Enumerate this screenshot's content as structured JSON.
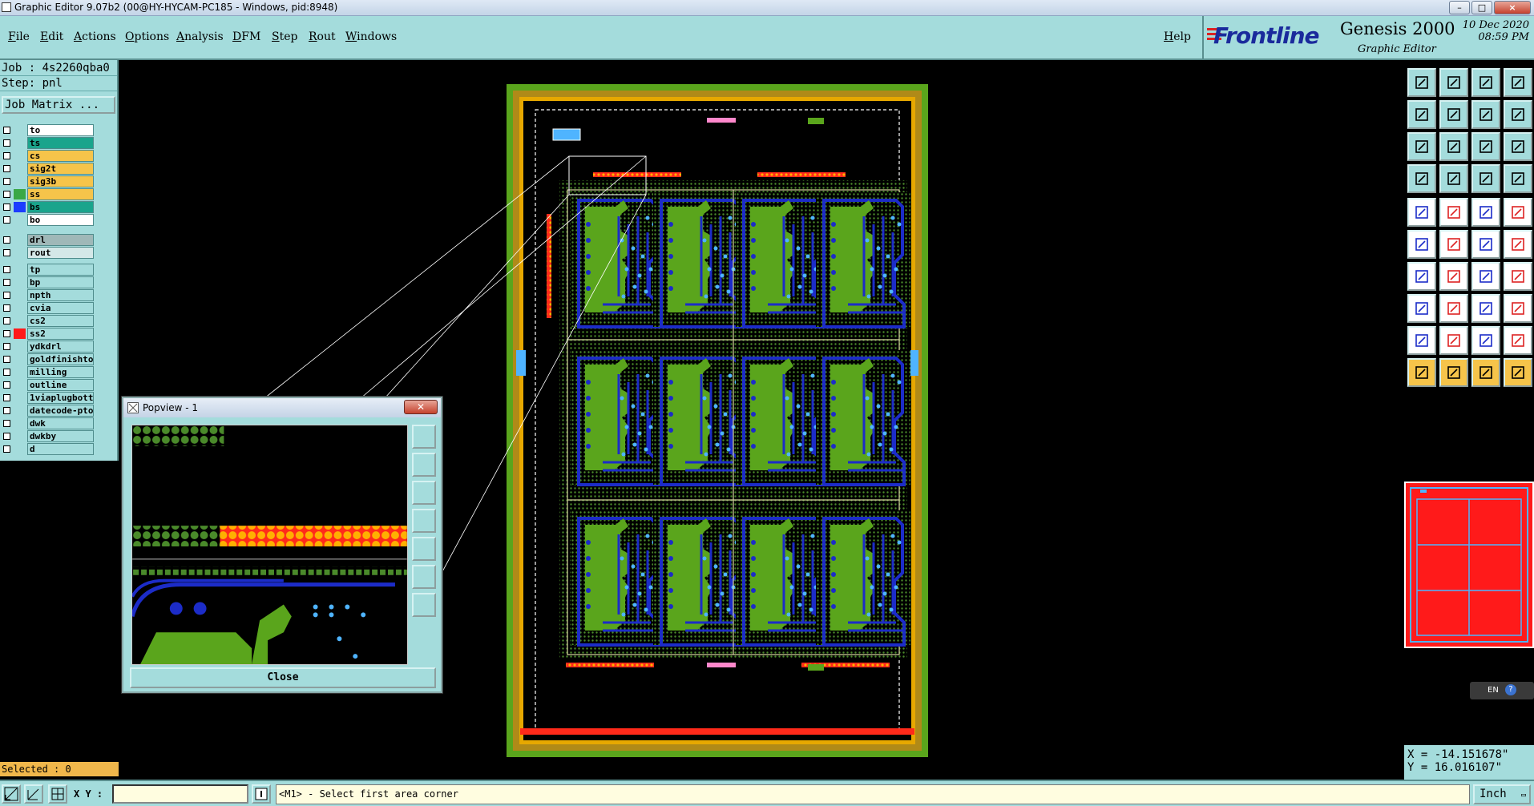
{
  "window": {
    "title": "Graphic Editor 9.07b2 (00@HY-HYCAM-PC185 - Windows, pid:8948)",
    "min_label": "–",
    "max_label": "□",
    "close_label": "×"
  },
  "menu": {
    "items": [
      "File",
      "Edit",
      "Actions",
      "Options",
      "Analysis",
      "DFM",
      "Step",
      "Rout",
      "Windows"
    ],
    "help": "Help"
  },
  "brand": {
    "logo": "Frontline",
    "product": "Genesis 2000",
    "subtitle": "Graphic Editor",
    "date": "10  Dec  2020",
    "time": "08:59  PM"
  },
  "job": {
    "job_line": "Job : 4s2260qba0",
    "step_line": "Step: pnl",
    "matrix_button": "Job Matrix ..."
  },
  "layers": [
    {
      "name": "to",
      "color": "#ffffff",
      "swatch": ""
    },
    {
      "name": "ts",
      "color": "#1aa48c",
      "swatch": ""
    },
    {
      "name": "cs",
      "color": "#f6c44a",
      "swatch": ""
    },
    {
      "name": "sig2t",
      "color": "#f6c44a",
      "swatch": ""
    },
    {
      "name": "sig3b",
      "color": "#f6c44a",
      "swatch": ""
    },
    {
      "name": "ss",
      "color": "#f6c44a",
      "swatch": "#39a845"
    },
    {
      "name": "bs",
      "color": "#1aa48c",
      "swatch": "#1c3cff"
    },
    {
      "name": "bo",
      "color": "#ffffff",
      "swatch": ""
    },
    {
      "name": "drl",
      "color": "#9fb8b8",
      "swatch": ""
    },
    {
      "name": "rout",
      "color": "#d4e8e8",
      "swatch": ""
    },
    {
      "name": "tp",
      "color": "#a4dcdc",
      "swatch": ""
    },
    {
      "name": "bp",
      "color": "#a4dcdc",
      "swatch": ""
    },
    {
      "name": "npth",
      "color": "#a4dcdc",
      "swatch": ""
    },
    {
      "name": "cvia",
      "color": "#a4dcdc",
      "swatch": ""
    },
    {
      "name": "cs2",
      "color": "#a4dcdc",
      "swatch": ""
    },
    {
      "name": "ss2",
      "color": "#a4dcdc",
      "swatch": "#ff1a1a"
    },
    {
      "name": "ydkdrl",
      "color": "#a4dcdc",
      "swatch": ""
    },
    {
      "name": "goldfinishto",
      "color": "#a4dcdc",
      "swatch": ""
    },
    {
      "name": "milling",
      "color": "#a4dcdc",
      "swatch": ""
    },
    {
      "name": "outline",
      "color": "#a4dcdc",
      "swatch": ""
    },
    {
      "name": "1viaplugbott",
      "color": "#a4dcdc",
      "swatch": ""
    },
    {
      "name": "datecode-pto",
      "color": "#a4dcdc",
      "swatch": ""
    },
    {
      "name": "dwk",
      "color": "#a4dcdc",
      "swatch": ""
    },
    {
      "name": "dwkby",
      "color": "#a4dcdc",
      "swatch": ""
    },
    {
      "name": "d",
      "color": "#a4dcdc",
      "swatch": ""
    }
  ],
  "status": {
    "selected": "Selected : 0",
    "xy_label": "X Y :",
    "xy_value": "",
    "prompt": "<M1> - Select first area corner",
    "units": "Inch",
    "coord_x": "X = -14.151678\"",
    "coord_y": "Y =  16.016107\""
  },
  "popview": {
    "title": "Popview - 1",
    "close_button": "Close"
  },
  "ime": {
    "lang": "EN"
  },
  "colors": {
    "panel": "#a4dcdc",
    "accent_yellow": "#f6c44a",
    "board_green": "#5aa51c",
    "trace_blue": "#1c2cc8",
    "hole_cyan": "#4fb4ff",
    "outer_frame": "#b08a18"
  }
}
